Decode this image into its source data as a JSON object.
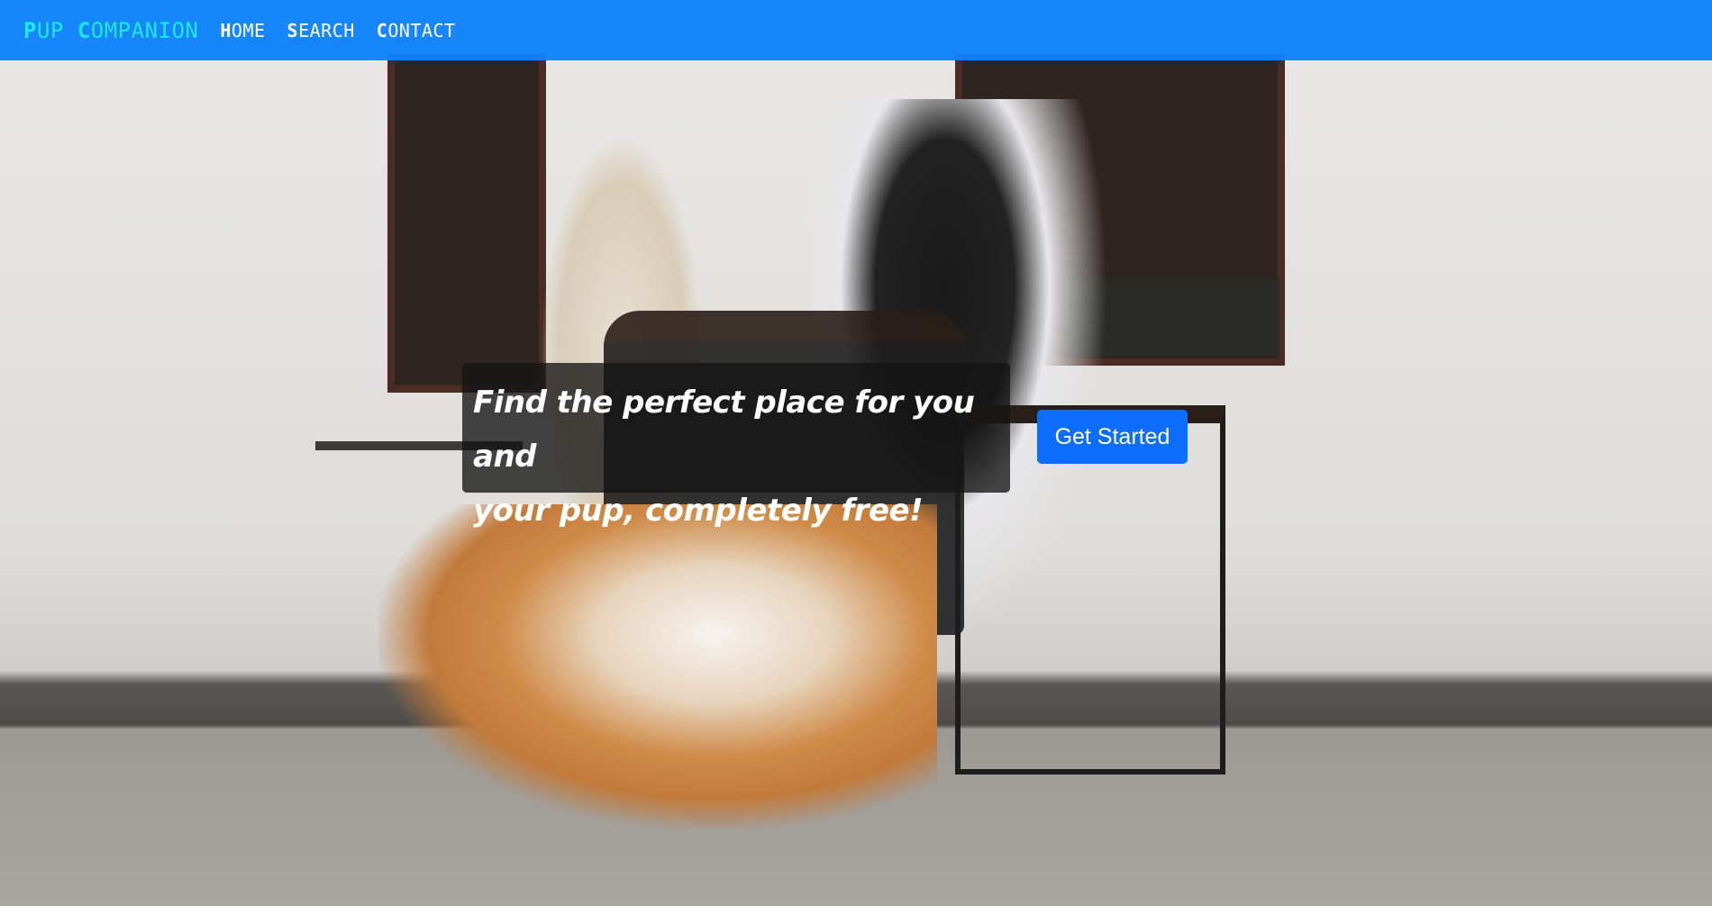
{
  "navbar": {
    "brand": {
      "first_initial": "P",
      "first_rest": "UP",
      "second_initial": "C",
      "second_rest": "OMPANION"
    },
    "links": [
      {
        "initial": "H",
        "rest": "OME"
      },
      {
        "initial": "S",
        "rest": "EARCH"
      },
      {
        "initial": "C",
        "rest": "ONTACT"
      }
    ],
    "color": "#1082fa",
    "brand_color": "#1ee8f5"
  },
  "hero": {
    "background_image": "photo of a corgi lying on pavement in front of two women at an outdoor cafe table",
    "tagline_line1": "Find the perfect place for you and",
    "tagline_line2": "your pup, completely free!",
    "cta_label": "Get Started",
    "cta_color": "#0d6efd"
  }
}
